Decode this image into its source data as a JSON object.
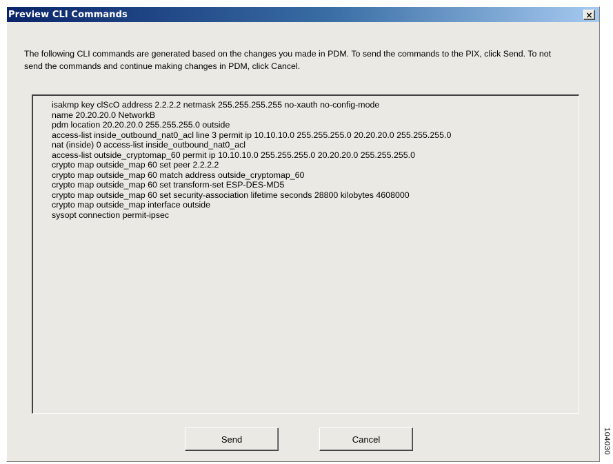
{
  "window": {
    "title": "Preview CLI Commands",
    "close_label": "×"
  },
  "description": "The following CLI commands are generated based on the changes you made in PDM.  To send the commands to the PIX, click Send.  To not send the commands and continue making changes in PDM, click Cancel.",
  "commands": [
    "isakmp key clScO address 2.2.2.2 netmask 255.255.255.255 no-xauth no-config-mode",
    "name 20.20.20.0 NetworkB",
    "pdm location 20.20.20.0 255.255.255.0 outside",
    "access-list inside_outbound_nat0_acl line 3 permit ip 10.10.10.0 255.255.255.0  20.20.20.0 255.255.255.0",
    "nat (inside) 0 access-list inside_outbound_nat0_acl",
    "access-list outside_cryptomap_60 permit ip 10.10.10.0 255.255.255.0  20.20.20.0 255.255.255.0",
    "crypto map outside_map 60 set peer 2.2.2.2",
    "crypto map outside_map 60 match address outside_cryptomap_60",
    "crypto map outside_map 60 set transform-set ESP-DES-MD5",
    "crypto map outside_map 60 set security-association lifetime seconds 28800 kilobytes 4608000",
    "crypto map outside_map interface outside",
    "sysopt connection permit-ipsec"
  ],
  "buttons": {
    "send_label": "Send",
    "cancel_label": "Cancel"
  },
  "figure_id": "104030"
}
